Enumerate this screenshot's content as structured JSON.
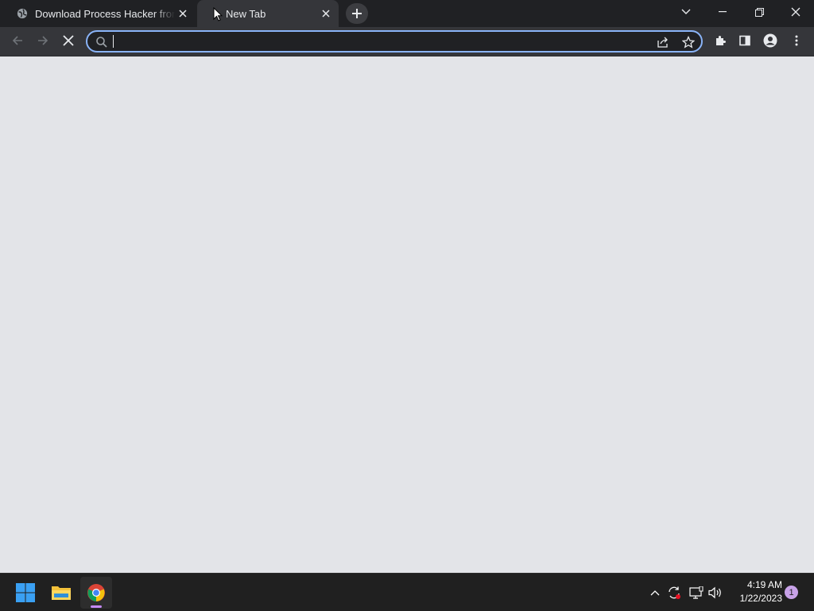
{
  "window": {
    "tabs": [
      {
        "title": "Download Process Hacker from S",
        "favicon": "globe-icon",
        "active": false
      },
      {
        "title": "New Tab",
        "favicon": "loading-icon",
        "active": true
      }
    ],
    "controls": [
      "chevron-down-icon",
      "minimize-icon",
      "restore-icon",
      "close-icon"
    ]
  },
  "toolbar": {
    "omnibox": {
      "value": "",
      "placeholder": ""
    },
    "buttons": [
      "back-icon",
      "forward-icon",
      "stop-icon",
      "share-icon",
      "star-icon",
      "extensions-icon",
      "side-panel-icon",
      "profile-icon",
      "menu-icon"
    ]
  },
  "taskbar": {
    "apps": [
      "windows-start-icon",
      "file-explorer-icon",
      "chrome-icon"
    ],
    "tray": [
      "chevron-up-icon",
      "sync-icon",
      "network-icon",
      "volume-icon"
    ],
    "clock": {
      "time": "4:19 AM",
      "date": "1/22/2023"
    },
    "notifications": "1"
  },
  "colors": {
    "tabstrip": "#202124",
    "toolbar": "#35363a",
    "accent": "#8ab4f8",
    "page_bg": "#e3e4e8",
    "taskbar": "#202020"
  }
}
